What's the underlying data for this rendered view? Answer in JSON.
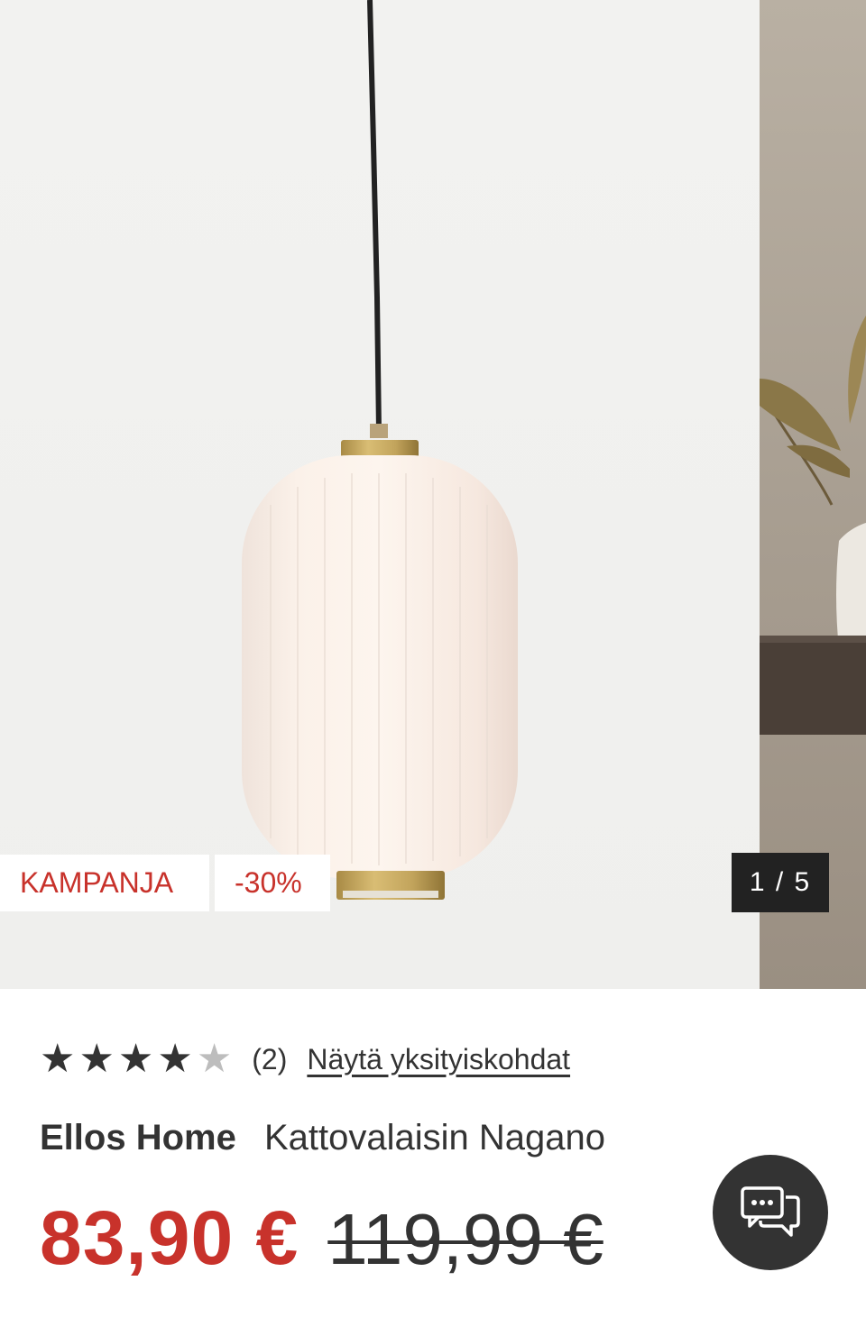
{
  "gallery": {
    "badge_campaign": "KAMPANJA",
    "badge_discount": "-30%",
    "counter": "1 / 5",
    "current_index": 1,
    "total_images": 5
  },
  "product": {
    "rating": 4,
    "rating_max": 5,
    "review_count": "(2)",
    "details_link": "Näytä yksityiskohdat",
    "brand": "Ellos Home",
    "name": "Kattovalaisin Nagano",
    "price_sale": "83,90 €",
    "price_original": "119,99 €"
  },
  "colors": {
    "sale_red": "#c8322b",
    "text_dark": "#333333",
    "badge_bg": "#ffffff",
    "counter_bg": "#222222",
    "star_off": "#bdbdbd"
  },
  "icons": {
    "chat": "chat-bubbles-icon",
    "star_filled": "star-filled-icon",
    "star_empty": "star-empty-icon"
  }
}
